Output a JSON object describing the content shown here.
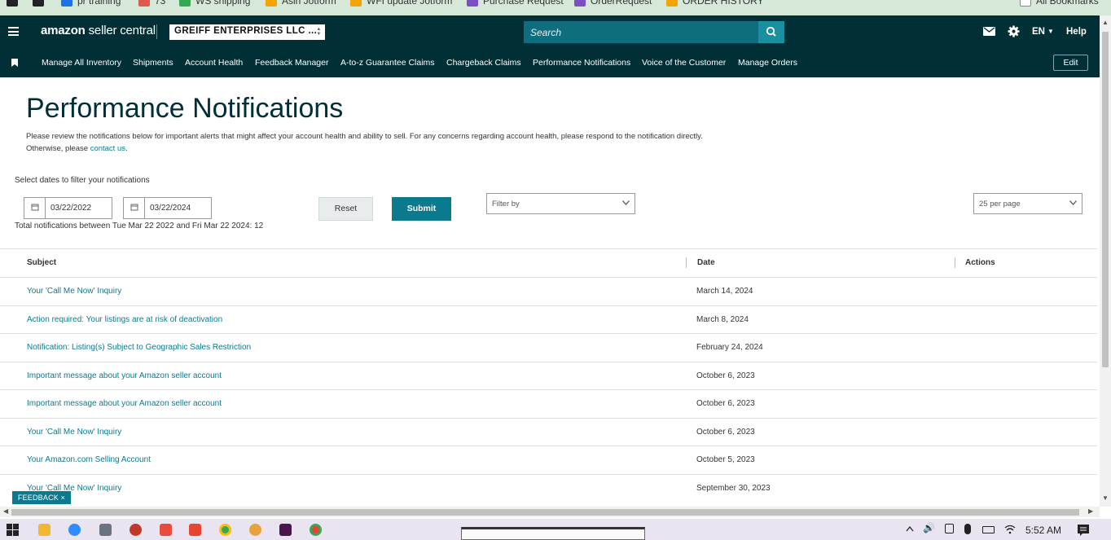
{
  "bookmarks": [
    {
      "label": "pr training",
      "color": "#1a73e8"
    },
    {
      "label": "73",
      "color": "#e05a4a"
    },
    {
      "label": "WS shipping",
      "color": "#34a853"
    },
    {
      "label": "Asin Jotform",
      "color": "#f4a300"
    },
    {
      "label": "WFI update Jotform",
      "color": "#f4a300"
    },
    {
      "label": "Purchase Request",
      "color": "#7b4fc4"
    },
    {
      "label": "OrderRequest",
      "color": "#7b4fc4"
    },
    {
      "label": "ORDER HISTORY",
      "color": "#f4a300"
    },
    {
      "label": "All Bookmarks",
      "color": "#888888"
    }
  ],
  "topbar": {
    "logo_brand": "amazon",
    "logo_rest": " seller central",
    "account": "GREIFF ENTERPRISES LLC ...",
    "search_placeholder": "Search",
    "language": "EN",
    "help": "Help"
  },
  "nav": {
    "items": [
      "Manage All Inventory",
      "Shipments",
      "Account Health",
      "Feedback Manager",
      "A-to-z Guarantee Claims",
      "Chargeback Claims",
      "Performance Notifications",
      "Voice of the Customer",
      "Manage Orders"
    ],
    "edit": "Edit"
  },
  "page": {
    "title": "Performance Notifications",
    "description": "Please review the notifications below for important alerts that might affect your account health and ability to sell. For any concerns regarding account health, please respond to the notification directly. Otherwise, please ",
    "contact_link": "contact us",
    "description_end": ".",
    "filter_label": "Select dates to filter your notifications",
    "date_from": "03/22/2022",
    "date_to": "03/22/2024",
    "reset": "Reset",
    "submit": "Submit",
    "filter_placeholder": "Filter by",
    "per_page": "25 per page",
    "total": "Total notifications between Tue Mar 22 2022 and Fri Mar 22 2024: 12"
  },
  "table": {
    "headers": {
      "subject": "Subject",
      "date": "Date",
      "actions": "Actions"
    },
    "rows": [
      {
        "subject": "Your 'Call Me Now' Inquiry",
        "date": "March 14, 2024"
      },
      {
        "subject": "Action required: Your listings are at risk of deactivation",
        "date": "March 8, 2024"
      },
      {
        "subject": "Notification: Listing(s) Subject to Geographic Sales Restriction",
        "date": "February 24, 2024"
      },
      {
        "subject": "Important message about your Amazon seller account",
        "date": "October 6, 2023"
      },
      {
        "subject": "Important message about your Amazon seller account",
        "date": "October 6, 2023"
      },
      {
        "subject": "Your 'Call Me Now' Inquiry",
        "date": "October 6, 2023"
      },
      {
        "subject": "Your Amazon.com Selling Account",
        "date": "October 5, 2023"
      },
      {
        "subject": "Your 'Call Me Now' Inquiry",
        "date": "September 30, 2023"
      }
    ]
  },
  "feedback": "FEEDBACK ×",
  "taskbar": {
    "time": "5:52 AM"
  },
  "colors": {
    "header_bg": "#002f36",
    "link": "#0b7a8f",
    "primary": "#0b7a8f"
  }
}
